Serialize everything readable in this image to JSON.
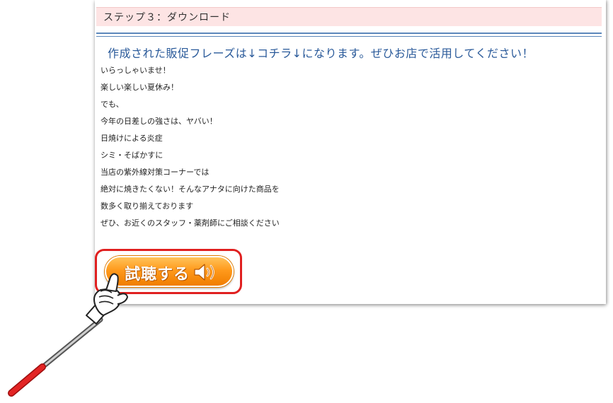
{
  "step": {
    "title": "ステップ３：ダウンロード"
  },
  "headline": "作成された販促フレーズは↓コチラ↓になります。ぜひお店で活用してください！",
  "phrases": [
    "いらっしゃいませ！",
    "楽しい楽しい夏休み！",
    "でも、",
    "今年の日差しの強さは、ヤバい！",
    "日焼けによる炎症",
    "シミ・そばかすに",
    "当店の紫外線対策コーナーでは",
    "絶対に焼きたくない！そんなアナタに向けた商品を",
    "数多く取り揃えております",
    "ぜひ、お近くのスタッフ・薬剤師にご相談ください"
  ],
  "listen_button": {
    "label": "試聴する",
    "icon": "speaker-icon"
  },
  "pointer": {
    "icon": "pointing-hand-icon"
  },
  "colors": {
    "header_bg": "#fde4e4",
    "rule": "#5b87bb",
    "headline_text": "#2a5a9a",
    "button_orange": "#ff9a1c",
    "highlight_red": "#e02020"
  }
}
